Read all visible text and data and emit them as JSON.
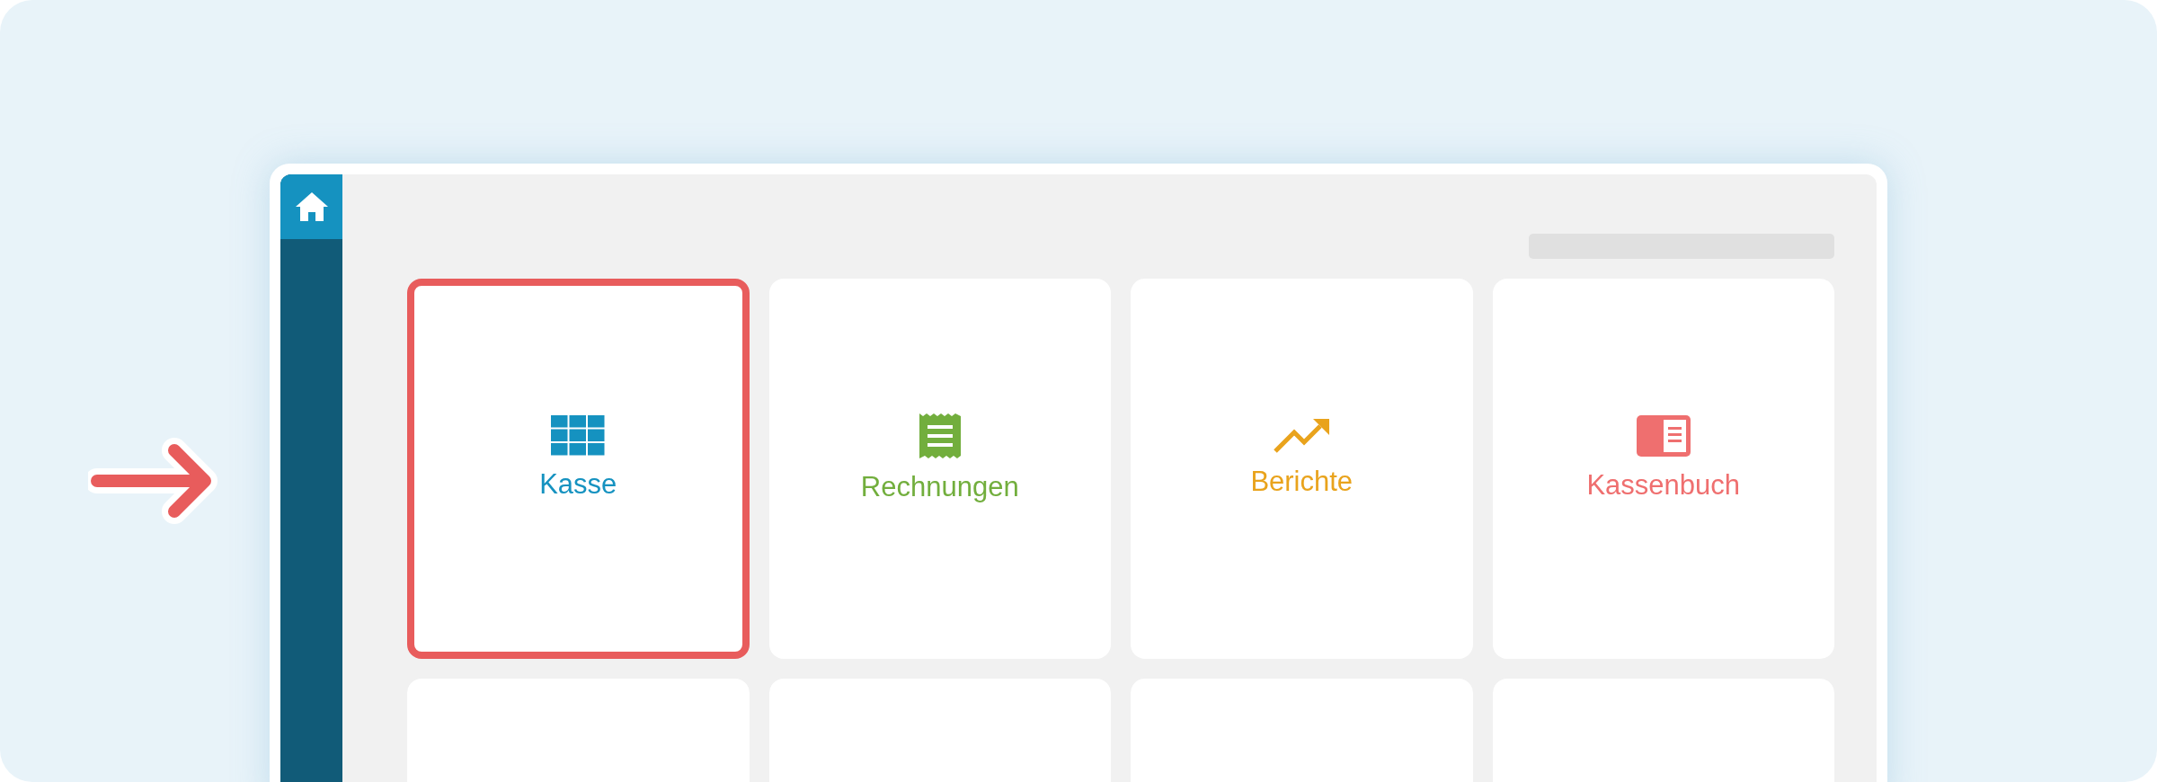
{
  "sidebar": {
    "items": [
      {
        "kind": "home",
        "selected": true
      }
    ]
  },
  "tiles": [
    {
      "kind": "register",
      "label": "Kasse",
      "color": "#1592c0",
      "selected": true
    },
    {
      "kind": "invoices",
      "label": "Rechnungen",
      "color": "#72ae3d",
      "selected": false
    },
    {
      "kind": "reports",
      "label": "Berichte",
      "color": "#e9a31c",
      "selected": false
    },
    {
      "kind": "cashbook",
      "label": "Kassenbuch",
      "color": "#ef6f6f",
      "selected": false
    },
    {
      "kind": "blank",
      "selected": false
    },
    {
      "kind": "blank",
      "selected": false
    },
    {
      "kind": "blank",
      "selected": false
    },
    {
      "kind": "blank",
      "selected": false
    }
  ]
}
